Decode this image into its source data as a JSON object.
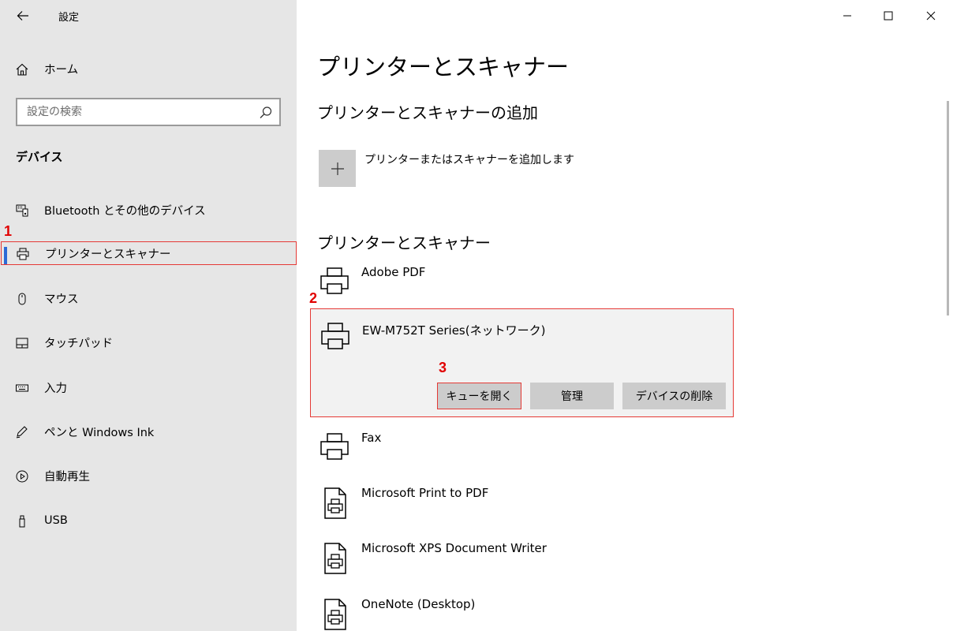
{
  "window": {
    "app_title": "設定"
  },
  "sidebar": {
    "home_label": "ホーム",
    "search_placeholder": "設定の検索",
    "section_title": "デバイス",
    "items": [
      {
        "label": "Bluetooth とその他のデバイス",
        "icon": "bluetooth-devices-icon"
      },
      {
        "label": "プリンターとスキャナー",
        "icon": "printer-icon",
        "active": true
      },
      {
        "label": "マウス",
        "icon": "mouse-icon"
      },
      {
        "label": "タッチパッド",
        "icon": "touchpad-icon"
      },
      {
        "label": "入力",
        "icon": "keyboard-icon"
      },
      {
        "label": "ペンと Windows Ink",
        "icon": "pen-icon"
      },
      {
        "label": "自動再生",
        "icon": "autoplay-icon"
      },
      {
        "label": "USB",
        "icon": "usb-icon"
      }
    ]
  },
  "main": {
    "page_title": "プリンターとスキャナー",
    "add_section_title": "プリンターとスキャナーの追加",
    "add_label": "プリンターまたはスキャナーを追加します",
    "list_section_title": "プリンターとスキャナー",
    "printers": [
      {
        "name": "Adobe PDF",
        "icon": "printer-icon"
      },
      {
        "name": "EW-M752T Series(ネットワーク)",
        "icon": "printer-icon",
        "selected": true
      },
      {
        "name": "Fax",
        "icon": "printer-icon"
      },
      {
        "name": "Microsoft Print to PDF",
        "icon": "document-printer-icon"
      },
      {
        "name": "Microsoft XPS Document Writer",
        "icon": "document-printer-icon"
      },
      {
        "name": "OneNote (Desktop)",
        "icon": "document-printer-icon"
      }
    ],
    "selected_buttons": {
      "open_queue": "キューを開く",
      "manage": "管理",
      "remove_device": "デバイスの削除"
    }
  },
  "annotations": {
    "step1": "1",
    "step2": "2",
    "step3": "3",
    "color": "#e10000"
  },
  "colors": {
    "sidebar_bg": "#e6e6e6",
    "accent": "#2b6bd6",
    "highlight_border": "#e53935",
    "button_bg": "#cccccc"
  }
}
